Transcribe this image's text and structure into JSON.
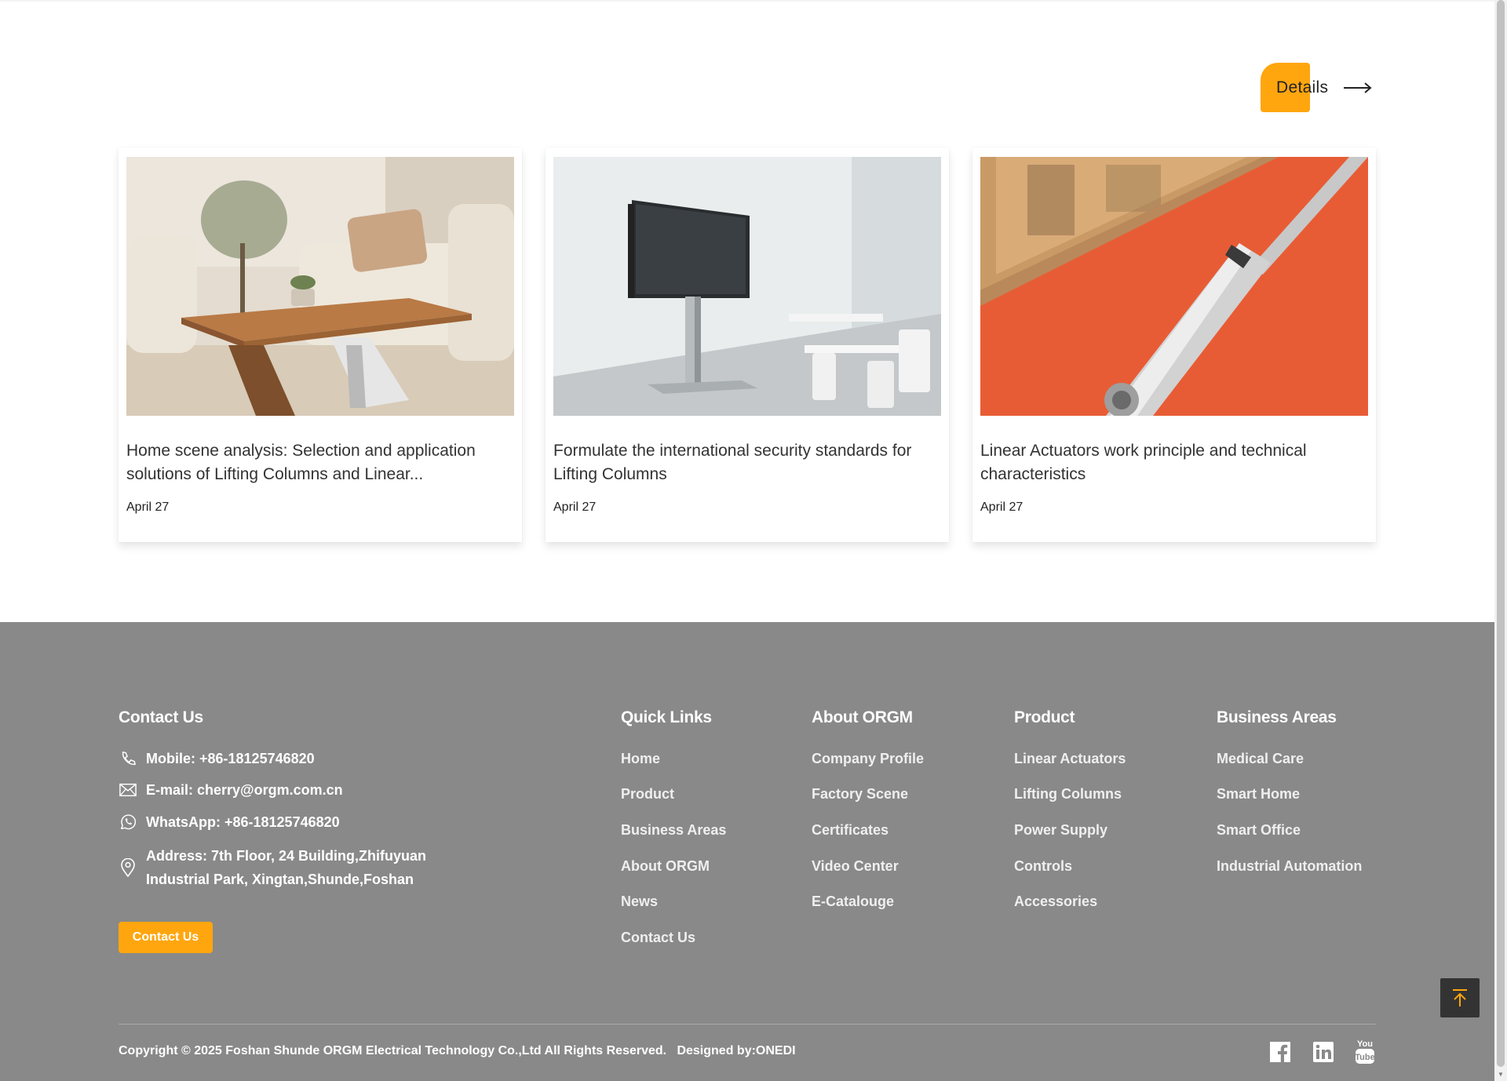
{
  "details": {
    "label": "Details"
  },
  "news": [
    {
      "title": "Home scene analysis: Selection and application solutions of Lifting Columns and Linear...",
      "date": "April 27"
    },
    {
      "title": "Formulate the international security standards for Lifting Columns",
      "date": "April 27"
    },
    {
      "title": "Linear Actuators work principle and technical characteristics",
      "date": "April 27"
    }
  ],
  "footer": {
    "contact": {
      "heading": "Contact Us",
      "mobile": "Mobile: +86-18125746820",
      "email": "E-mail: cherry@orgm.com.cn",
      "whatsapp": "WhatsApp: +86-18125746820",
      "address_line1": "Address: 7th Floor, 24 Building,Zhifuyuan",
      "address_line2": "Industrial Park, Xingtan,Shunde,Foshan",
      "button": "Contact Us"
    },
    "quick_links": {
      "heading": "Quick Links",
      "items": [
        "Home",
        "Product",
        "Business Areas",
        "About ORGM",
        "News",
        "Contact Us"
      ]
    },
    "about": {
      "heading": "About ORGM",
      "items": [
        "Company Profile",
        "Factory Scene",
        "Certificates",
        "Video Center",
        "E-Catalouge"
      ]
    },
    "product": {
      "heading": "Product",
      "items": [
        "Linear Actuators",
        "Lifting Columns",
        "Power Supply",
        "Controls",
        "Accessories"
      ]
    },
    "business": {
      "heading": "Business Areas",
      "items": [
        "Medical Care",
        "Smart Home",
        "Smart Office",
        "Industrial Automation"
      ]
    },
    "copyright": "Copyright © 2025 Foshan Shunde ORGM Electrical Technology Co.,Ltd All Rights Reserved.   Designed by:ONEDI",
    "social": [
      "facebook-icon",
      "linkedin-icon",
      "youtube-icon"
    ],
    "youtube_text": [
      "You",
      "Tube"
    ]
  },
  "colors": {
    "accent": "#ffa60f",
    "footer_bg": "#898989"
  }
}
